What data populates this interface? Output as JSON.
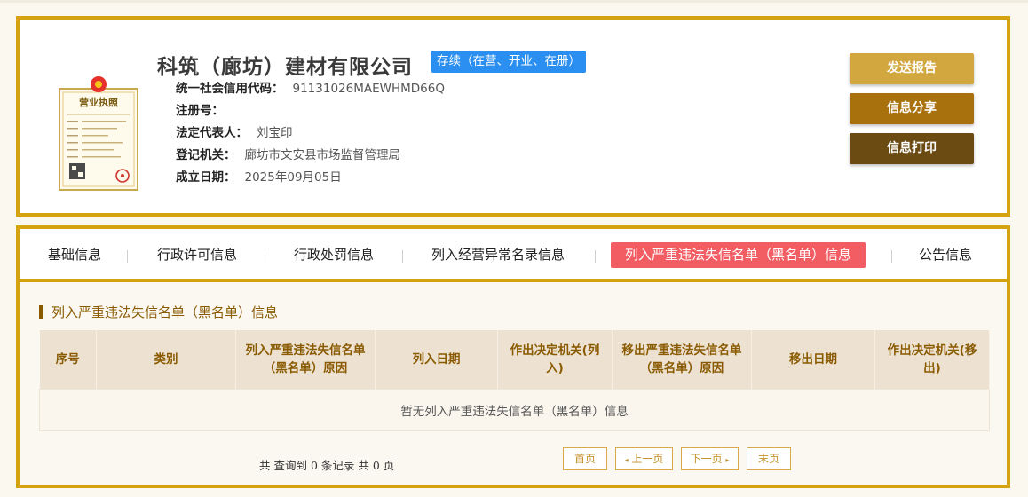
{
  "company": {
    "name": "科筑（廊坊）建材有限公司",
    "status": "存续（在营、开业、在册）",
    "fields": [
      {
        "label": "统一社会信用代码：",
        "value": "91131026MAEWHMD66Q"
      },
      {
        "label": "注册号：",
        "value": ""
      },
      {
        "label": "法定代表人：",
        "value": "刘宝印"
      },
      {
        "label": "登记机关：",
        "value": "廊坊市文安县市场监督管理局"
      },
      {
        "label": "成立日期：",
        "value": "2025年09月05日"
      }
    ]
  },
  "license_image": {
    "title": "营业执照",
    "colors": {
      "frame": "#c9a84f",
      "paper": "#fffbec",
      "seal": "#d0342c",
      "emblem": "#e4312b"
    }
  },
  "actions": {
    "send_report": "发送报告",
    "share": "信息分享",
    "print": "信息打印"
  },
  "tabs": [
    {
      "label": "基础信息",
      "active": false
    },
    {
      "label": "行政许可信息",
      "active": false
    },
    {
      "label": "行政处罚信息",
      "active": false
    },
    {
      "label": "列入经营异常名录信息",
      "active": false
    },
    {
      "label": "列入严重违法失信名单（黑名单）信息",
      "active": true
    },
    {
      "label": "公告信息",
      "active": false
    }
  ],
  "section": {
    "title": "列入严重违法失信名单（黑名单）信息"
  },
  "table": {
    "columns": [
      "序号",
      "类别",
      "列入严重违法失信名单（黑名单）原因",
      "列入日期",
      "作出决定机关(列入)",
      "移出严重违法失信名单（黑名单）原因",
      "移出日期",
      "作出决定机关(移出)"
    ],
    "empty_message": "暂无列入严重违法失信名单（黑名单）信息"
  },
  "pagination": {
    "summary": "共 查询到 0 条记录 共 0 页",
    "first": "首页",
    "prev": "上一页",
    "next": "下一页",
    "last": "末页",
    "prev_arrow": "◂",
    "next_arrow": "▸"
  },
  "colors": {
    "accent_gold": "#d4a30f",
    "status_blue": "#2a8ff0",
    "active_tab_red": "#f25c63",
    "header_text_brown": "#8a5a00"
  }
}
